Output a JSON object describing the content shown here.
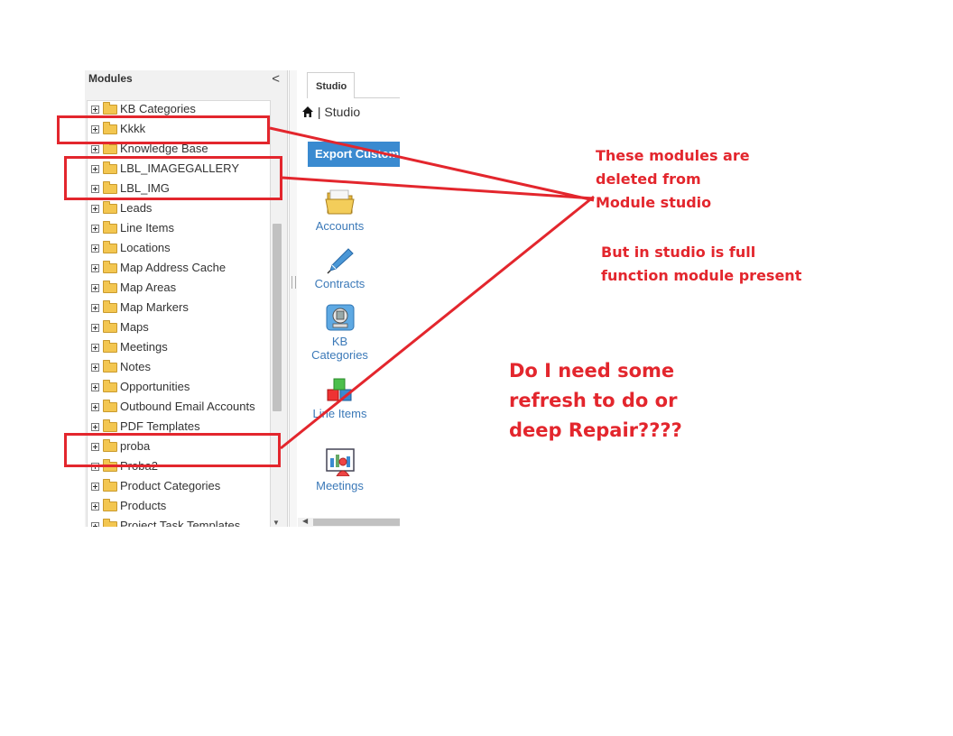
{
  "modules_panel": {
    "title": "Modules",
    "collapse_glyph": "<",
    "items": [
      {
        "label": "KB Categories"
      },
      {
        "label": "Kkkk"
      },
      {
        "label": "Knowledge Base"
      },
      {
        "label": "LBL_IMAGEGALLERY"
      },
      {
        "label": "LBL_IMG"
      },
      {
        "label": "Leads"
      },
      {
        "label": "Line Items"
      },
      {
        "label": "Locations"
      },
      {
        "label": "Map Address Cache"
      },
      {
        "label": "Map Areas"
      },
      {
        "label": "Map Markers"
      },
      {
        "label": "Maps"
      },
      {
        "label": "Meetings"
      },
      {
        "label": "Notes"
      },
      {
        "label": "Opportunities"
      },
      {
        "label": "Outbound Email Accounts"
      },
      {
        "label": "PDF Templates"
      },
      {
        "label": "proba"
      },
      {
        "label": "Proba2"
      },
      {
        "label": "Product Categories"
      },
      {
        "label": "Products"
      },
      {
        "label": "Project Task Templates"
      }
    ]
  },
  "studio_panel": {
    "tab_label": "Studio",
    "breadcrumb_text": "| Studio",
    "export_label": "Export Customizations",
    "items": [
      {
        "label_line1": "Accounts",
        "label_line2": "",
        "icon": "folder-icon"
      },
      {
        "label_line1": "Contracts",
        "label_line2": "",
        "icon": "pen-icon"
      },
      {
        "label_line1": "KB",
        "label_line2": "Categories",
        "icon": "kb-icon"
      },
      {
        "label_line1": "Line Items",
        "label_line2": "",
        "icon": "cubes-icon"
      },
      {
        "label_line1": "Meetings",
        "label_line2": "",
        "icon": "meeting-icon"
      }
    ]
  },
  "annotations": {
    "note1_line1": "These modules are",
    "note1_line2": "deleted from",
    "note1_line3": "Module studio",
    "note2_line1": "But in studio is full",
    "note2_line2": "function module present",
    "note3_line1": "Do I need some",
    "note3_line2": "refresh to do or",
    "note3_line3": "deep Repair????",
    "color": "#e3262d"
  },
  "colors": {
    "export_button": "#3a8ad0",
    "link": "#3b79b8",
    "folder": "#f3c650"
  }
}
